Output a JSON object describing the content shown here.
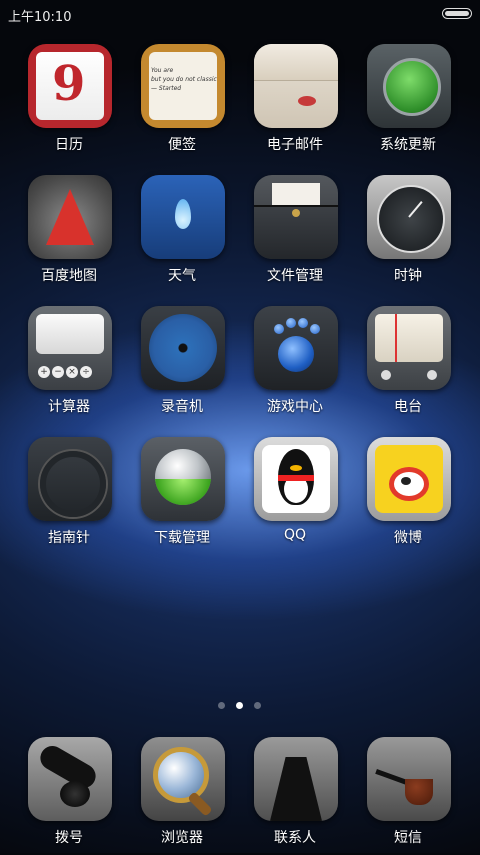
{
  "status_bar": {
    "time": "上午10:10"
  },
  "apps": [
    {
      "label": "日历",
      "icon": "calendar-icon"
    },
    {
      "label": "便签",
      "icon": "notes-icon"
    },
    {
      "label": "电子邮件",
      "icon": "email-icon"
    },
    {
      "label": "系统更新",
      "icon": "system-update-icon"
    },
    {
      "label": "百度地图",
      "icon": "baidu-map-icon"
    },
    {
      "label": "天气",
      "icon": "weather-icon"
    },
    {
      "label": "文件管理",
      "icon": "file-manager-icon"
    },
    {
      "label": "时钟",
      "icon": "clock-icon"
    },
    {
      "label": "计算器",
      "icon": "calculator-icon"
    },
    {
      "label": "录音机",
      "icon": "recorder-icon"
    },
    {
      "label": "游戏中心",
      "icon": "game-center-icon"
    },
    {
      "label": "电台",
      "icon": "radio-icon"
    },
    {
      "label": "指南针",
      "icon": "compass-icon"
    },
    {
      "label": "下载管理",
      "icon": "download-manager-icon"
    },
    {
      "label": "QQ",
      "icon": "qq-icon"
    },
    {
      "label": "微博",
      "icon": "weibo-icon"
    }
  ],
  "dock": [
    {
      "label": "拨号",
      "icon": "phone-dialer-icon"
    },
    {
      "label": "浏览器",
      "icon": "browser-icon"
    },
    {
      "label": "联系人",
      "icon": "contacts-icon"
    },
    {
      "label": "短信",
      "icon": "messages-icon"
    }
  ],
  "calendar_icon_text": "9",
  "memo_icon_text": "You are\nbut you do not classic\n— Started",
  "page_indicator": {
    "pages": 3,
    "active": 2
  }
}
